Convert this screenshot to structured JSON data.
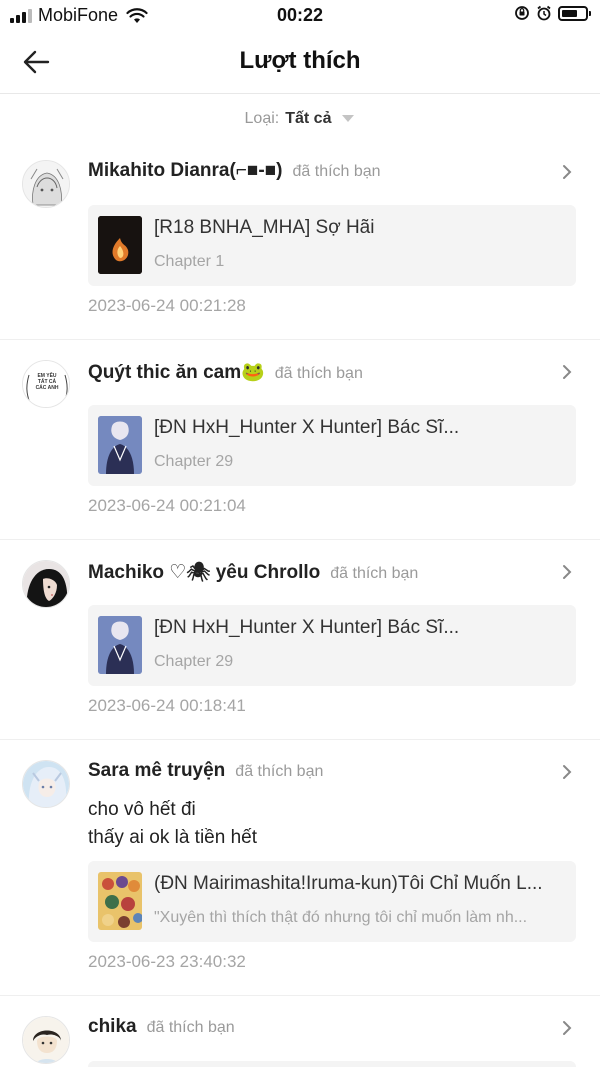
{
  "status_bar": {
    "carrier": "MobiFone",
    "time": "00:22"
  },
  "header": {
    "title": "Lượt thích"
  },
  "filter": {
    "label": "Loại:",
    "value": "Tất cả"
  },
  "items": [
    {
      "user": "Mikahito Dianra(⌐■-■)",
      "action": "đã thích bạn",
      "story_title": "[R18 BNHA_MHA] Sợ Hãi",
      "story_sub": "Chapter 1",
      "timestamp": "2023-06-24 00:21:28"
    },
    {
      "user": "Quýt thic ăn cam🐸",
      "action": "đã thích bạn",
      "avatar_text": "EM YÊU TẤT CẢ CÁC ANH",
      "story_title": "[ĐN HxH_Hunter X Hunter] Bác Sĩ...",
      "story_sub": "Chapter 29",
      "timestamp": "2023-06-24 00:21:04"
    },
    {
      "user": "Machiko ♡🕷 yêu Chrollo",
      "action": "đã thích bạn",
      "story_title": "[ĐN HxH_Hunter X Hunter] Bác Sĩ...",
      "story_sub": "Chapter 29",
      "timestamp": "2023-06-24 00:18:41"
    },
    {
      "user": "Sara mê truyện",
      "action": "đã thích bạn",
      "comment_line1": "cho vô hết đi",
      "comment_line2": "thấy ai ok là tiền hết",
      "story_title": "(ĐN Mairimashita!Iruma-kun)Tôi Chỉ Muốn L...",
      "story_sub": "\"Xuyên thì thích thật đó nhưng tôi chỉ muốn làm nh...",
      "timestamp": "2023-06-23 23:40:32"
    },
    {
      "user": "chika",
      "action": "đã thích bạn"
    }
  ]
}
